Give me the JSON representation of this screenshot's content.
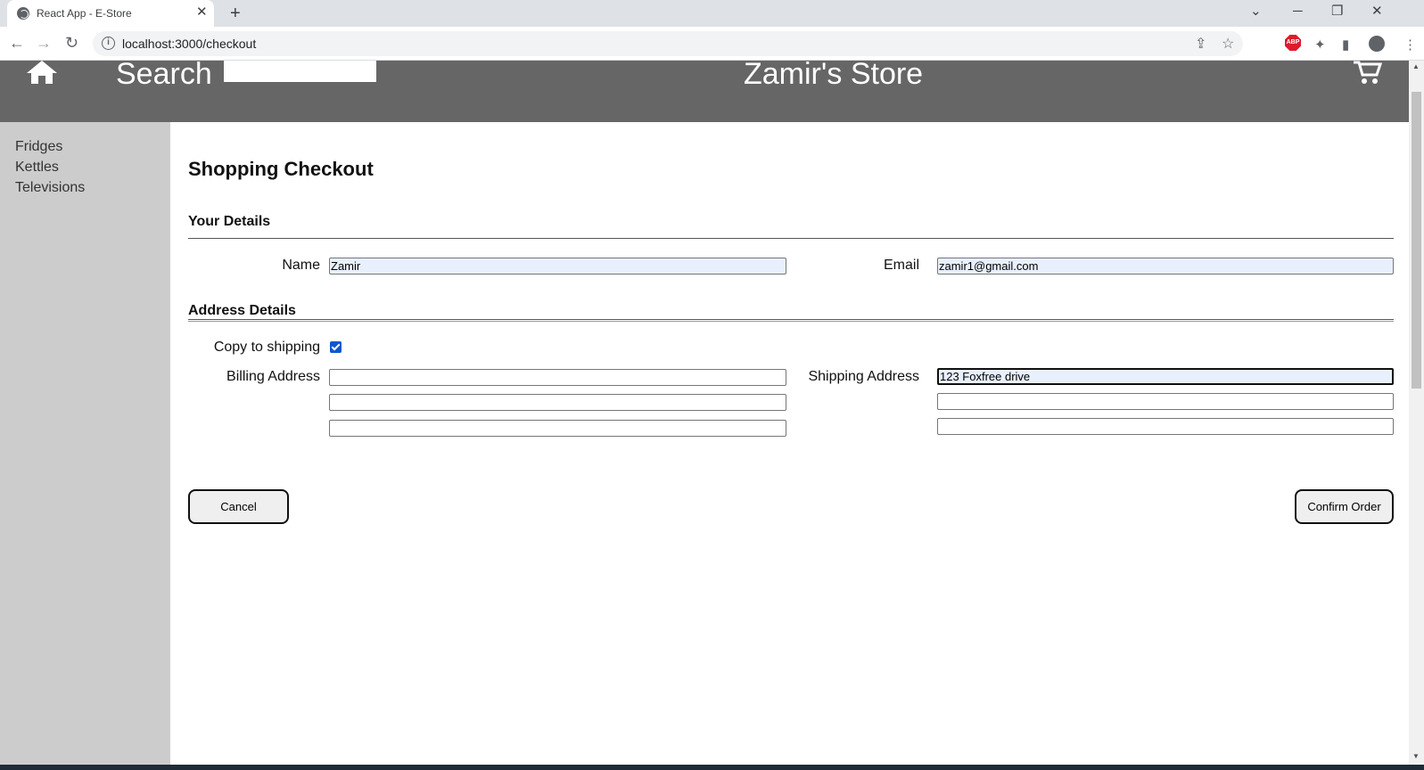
{
  "browser": {
    "tab_title": "React App - E-Store",
    "url": "localhost:3000/checkout"
  },
  "header": {
    "search_label": "Search",
    "store_title": "Zamir's Store"
  },
  "sidebar": {
    "items": [
      {
        "label": "Fridges"
      },
      {
        "label": "Kettles"
      },
      {
        "label": "Televisions"
      }
    ]
  },
  "checkout": {
    "title": "Shopping Checkout",
    "your_details_heading": "Your Details",
    "name_label": "Name",
    "name_value": "Zamir",
    "email_label": "Email",
    "email_value": "zamir1@gmail.com",
    "address_heading": "Address Details",
    "copy_to_shipping_label": "Copy to shipping",
    "copy_to_shipping_checked": true,
    "billing_label": "Billing Address",
    "billing_lines": [
      "",
      "",
      ""
    ],
    "shipping_label": "Shipping Address",
    "shipping_lines": [
      "123 Foxfree drive",
      "",
      ""
    ],
    "cancel_label": "Cancel",
    "confirm_label": "Confirm Order"
  },
  "colors": {
    "header_bg": "#666666",
    "sidebar_bg": "#cccccc",
    "autofill_bg": "#e8f0fe"
  }
}
